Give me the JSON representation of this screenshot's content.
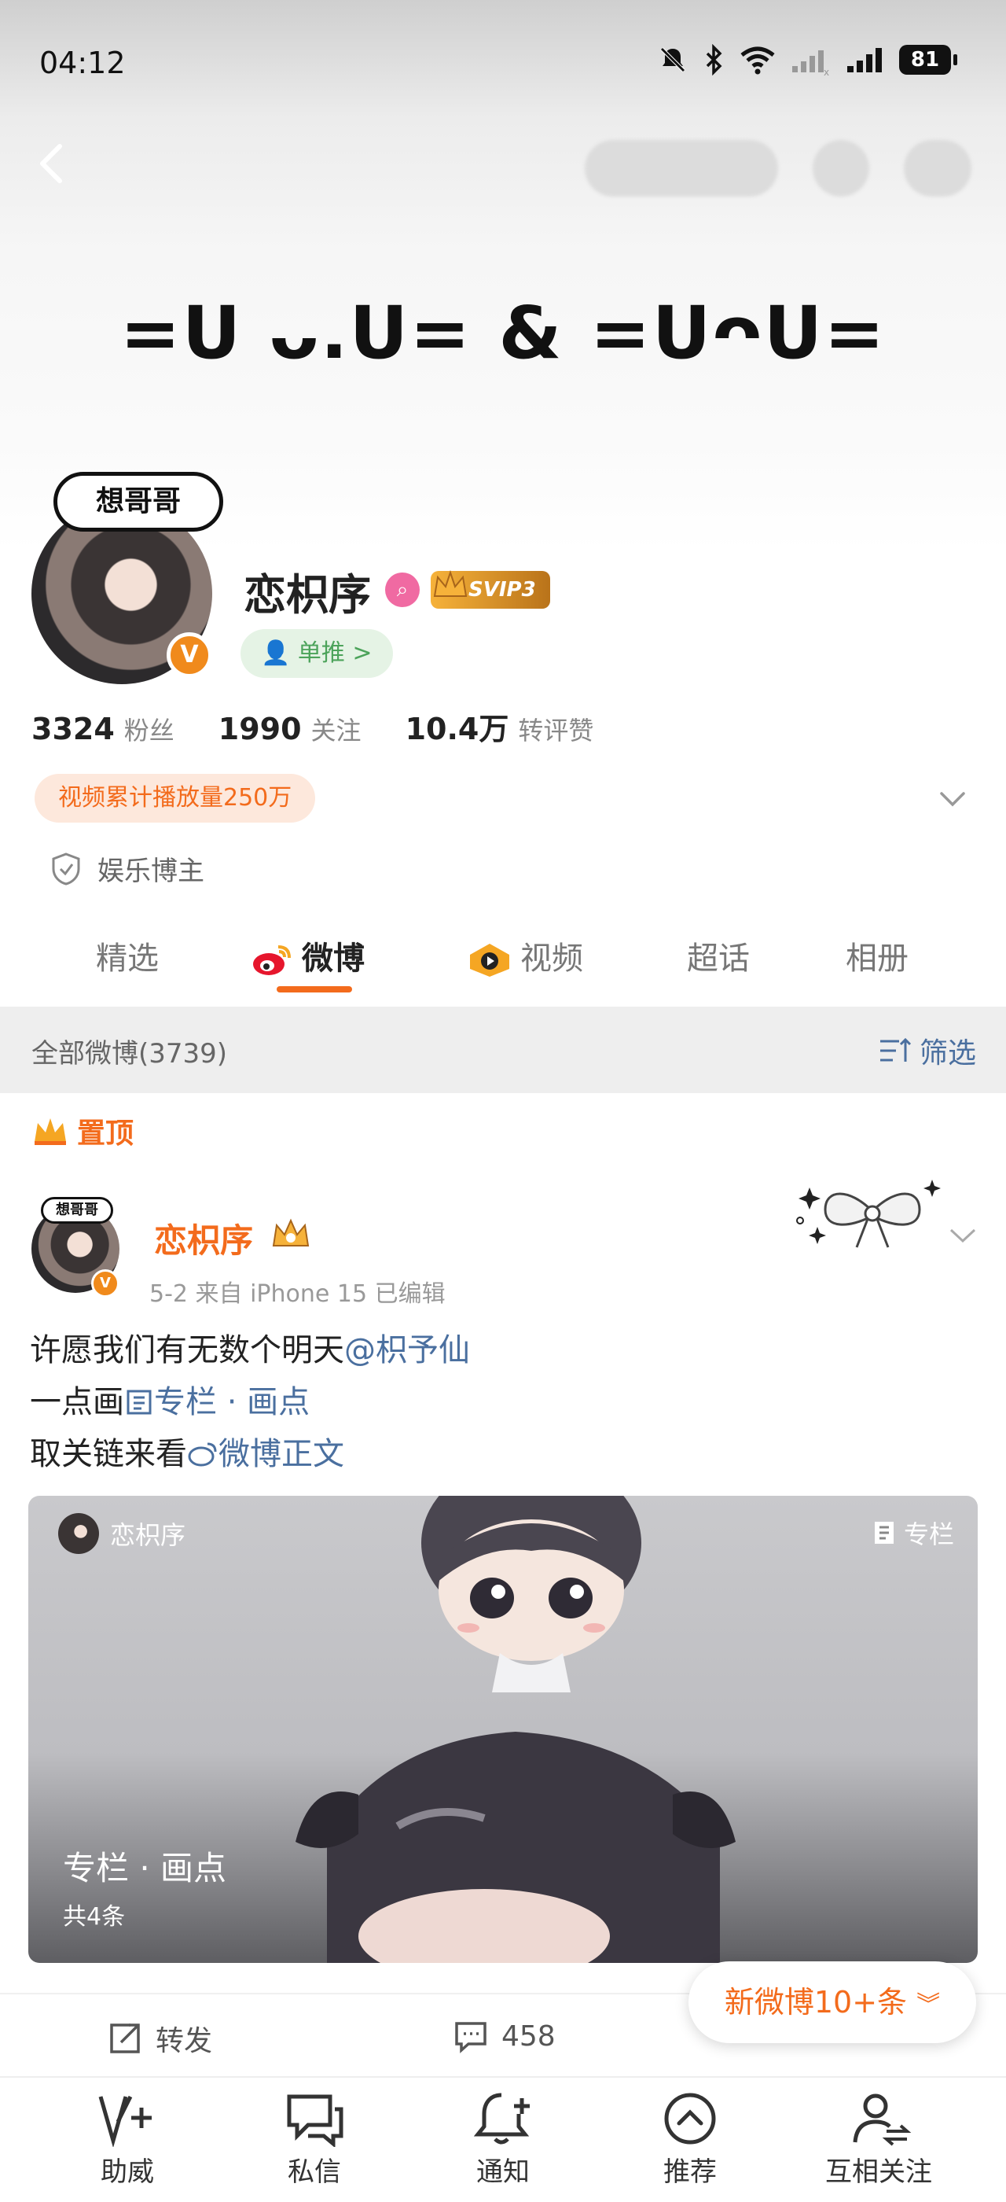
{
  "status_bar": {
    "time": "04:12",
    "battery": "81"
  },
  "banner": {
    "kaomoji": "=ᑌ ᴗ.ᑌ= & =ᑌᴖᑌ="
  },
  "profile": {
    "avatar_bubble": "想哥哥",
    "v_badge": "V",
    "name": "恋枳序",
    "svip": "SVIP3",
    "single_pill": "单推 >",
    "stats": [
      {
        "num": "3324",
        "label": "粉丝"
      },
      {
        "num": "1990",
        "label": "关注"
      },
      {
        "num": "10.4万",
        "label": "转评赞"
      }
    ],
    "video_pill": "视频累计播放量250万",
    "category": "娱乐博主"
  },
  "tabs": [
    {
      "label": "精选",
      "active": false
    },
    {
      "label": "微博",
      "active": true
    },
    {
      "label": "视频",
      "active": false
    },
    {
      "label": "超话",
      "active": false
    },
    {
      "label": "相册",
      "active": false
    }
  ],
  "filter": {
    "all_label": "全部微博(3739)",
    "filter_label": "筛选"
  },
  "post": {
    "pinned_label": "置顶",
    "avatar_bubble": "想哥哥",
    "author": "恋枳序",
    "meta": "5-2  来自 iPhone 15  已编辑",
    "line1_text": "许愿我们有无数个明天",
    "line1_mention": "@枳予仙",
    "line2_text": " 一点画",
    "line2_link": "专栏 · 画点",
    "line3_text": "取关链来看",
    "line3_link": "微博正文",
    "card": {
      "author": "恋枳序",
      "tag": "专栏",
      "title": "专栏 · 画点",
      "count": "共4条"
    },
    "actions": {
      "repost": "转发",
      "comments": "458"
    }
  },
  "new_weibo_pill": "新微博10+条",
  "bottom_nav": [
    {
      "label": "助威",
      "icon": "cheer-icon"
    },
    {
      "label": "私信",
      "icon": "message-icon"
    },
    {
      "label": "通知",
      "icon": "bell-plus-icon"
    },
    {
      "label": "推荐",
      "icon": "recommend-icon"
    },
    {
      "label": "互相关注",
      "icon": "mutual-follow-icon"
    }
  ],
  "colors": {
    "accent": "#f36b1c",
    "link": "#4a6f9f",
    "green": "#4ca35a",
    "vip_gold": "#f6b23a"
  }
}
